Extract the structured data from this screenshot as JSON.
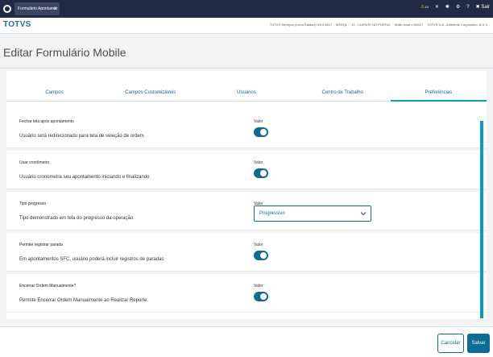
{
  "browser_tab": {
    "title": "Formulário Apontamer",
    "close": "x"
  },
  "top_actions": {
    "notification_count": "10",
    "logout_label": "Sair"
  },
  "brand": "TOTVS",
  "env_info": [
    "TOTVS Serviços (Linha Datasul) V8.9.5617",
    "MSSQL",
    "13 - CLIENTE NO PORTAL",
    "Abilio local  c:\\db117",
    "TOTVS S.A - Ambiente Corporativo 11.5.3..."
  ],
  "page_title": "Editar Formulário Mobile",
  "tabs": [
    {
      "label": "Campos",
      "active": false
    },
    {
      "label": "Campos Customizáveis",
      "active": false
    },
    {
      "label": "Usuários",
      "active": false
    },
    {
      "label": "Centro de Trabalho",
      "active": false
    },
    {
      "label": "Preferências",
      "active": true
    }
  ],
  "preferences": [
    {
      "name": "Fechar tela após apontamento",
      "description": "Usuário será redirecionado para tela de seleção de ordem",
      "value_label": "Valor",
      "toggle_on": true
    },
    {
      "name": "Usar cronômetro",
      "description": "Usuário cronometra seu apontamento iniciando e finalizando",
      "value_label": "Valor",
      "toggle_on": true
    },
    {
      "name": "Tipo progresso",
      "description": "Tipo demonstrado em tela do progresso da operação",
      "value_label": "Valor",
      "select_value": "Progressivo"
    },
    {
      "name": "Permite registrar parada",
      "description": "Em apontamentos SFC, usuário poderá incluir registros de paradas",
      "value_label": "Valor",
      "toggle_on": true
    },
    {
      "name": "Encerrar Ordem Manualmente?",
      "description": "Permite Encerrar Ordem Manualmente ao Realizar Reporte.",
      "value_label": "Valor",
      "toggle_on": true
    }
  ],
  "footer": {
    "cancel_label": "Cancelar",
    "save_label": "Salvar"
  },
  "colors": {
    "primary": "#0c6c94",
    "accent": "#0c9abe",
    "topbar": "#1f2b44"
  }
}
